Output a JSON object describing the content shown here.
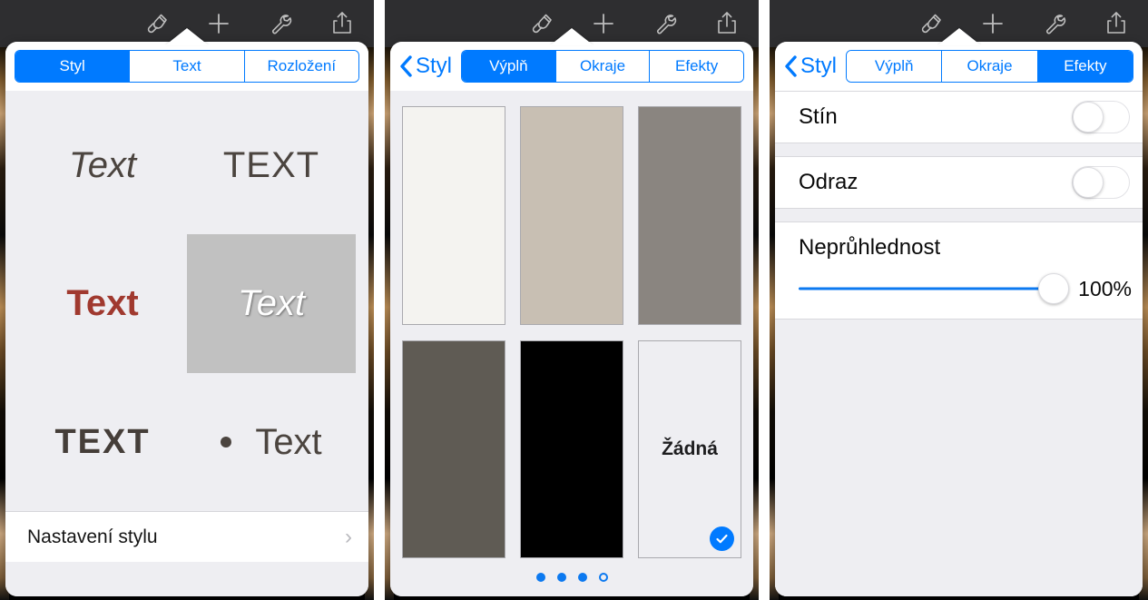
{
  "toolbar": {
    "icons": [
      {
        "name": "format-brush-icon",
        "label": "Formát"
      },
      {
        "name": "insert-plus-icon",
        "label": "Vložit"
      },
      {
        "name": "tools-wrench-icon",
        "label": "Nástroje"
      },
      {
        "name": "share-icon",
        "label": "Sdílet"
      }
    ]
  },
  "panel1": {
    "tabs": [
      {
        "label": "Styl",
        "active": true
      },
      {
        "label": "Text",
        "active": false
      },
      {
        "label": "Rozložení",
        "active": false
      }
    ],
    "styles": [
      {
        "text": "Text",
        "variant": "italic-gray",
        "selected": false
      },
      {
        "text": "TEXT",
        "variant": "caps-gray",
        "selected": false
      },
      {
        "text": "Text",
        "variant": "bold-red",
        "selected": false
      },
      {
        "text": "Text",
        "variant": "italic-white-on-gray",
        "selected": true
      },
      {
        "text": "TEXT",
        "variant": "bold-caps-dark",
        "selected": false
      },
      {
        "text": "Text",
        "variant": "bulleted-gray",
        "selected": false
      }
    ],
    "settings_row": {
      "label": "Nastavení stylu",
      "disclosure": "›"
    }
  },
  "panel2": {
    "back": {
      "label": "Styl",
      "icon": "chevron-left-icon"
    },
    "tabs": [
      {
        "label": "Výplň",
        "active": true
      },
      {
        "label": "Okraje",
        "active": false
      },
      {
        "label": "Efekty",
        "active": false
      }
    ],
    "swatches": [
      {
        "color": "#f4f3f0",
        "label": "",
        "selected": false
      },
      {
        "color": "#c8bfb3",
        "label": "",
        "selected": false
      },
      {
        "color": "#8a8580",
        "label": "",
        "selected": false
      },
      {
        "color": "#5f5b54",
        "label": "",
        "selected": false
      },
      {
        "color": "#000000",
        "label": "",
        "selected": false
      },
      {
        "color": "",
        "label": "Žádná",
        "selected": true
      }
    ],
    "pager": {
      "total": 4,
      "current": 4
    }
  },
  "panel3": {
    "back": {
      "label": "Styl",
      "icon": "chevron-left-icon"
    },
    "tabs": [
      {
        "label": "Výplň",
        "active": false
      },
      {
        "label": "Okraje",
        "active": false
      },
      {
        "label": "Efekty",
        "active": true
      }
    ],
    "rows": [
      {
        "label": "Stín",
        "toggle": "off"
      },
      {
        "label": "Odraz",
        "toggle": "off"
      }
    ],
    "opacity": {
      "label": "Neprůhlednost",
      "value": "100%",
      "percent": 100
    }
  },
  "colors": {
    "accent": "#007aff",
    "pager_dot": "#0c79f0",
    "popover_bg": "#eeeef2",
    "toolbar_bg": "#2e2e30",
    "style_red": "#a0392f",
    "style_dark": "#4b443f"
  }
}
